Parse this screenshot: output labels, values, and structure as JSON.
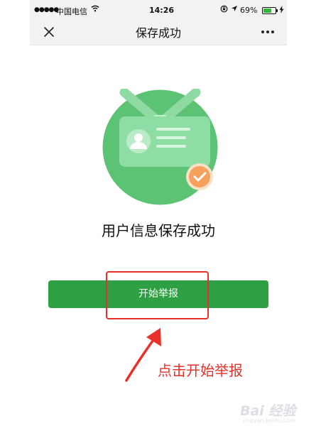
{
  "status_bar": {
    "signal": "●●●●●",
    "carrier": "中国电信",
    "time": "14:26",
    "battery_percent": "69%",
    "battery_level": 0.69
  },
  "nav": {
    "title": "保存成功"
  },
  "main": {
    "success_text": "用户信息保存成功",
    "start_report_button": "开始举报"
  },
  "annotation": {
    "text": "点击开始举报"
  },
  "watermark": {
    "text": "Bai 经验",
    "sub": "jingyan.baidu.com"
  },
  "colors": {
    "primary_green": "#2ea043",
    "illustration_green": "#5cc375",
    "check_orange": "#f5a05c",
    "annotation_red": "#e8302a"
  }
}
